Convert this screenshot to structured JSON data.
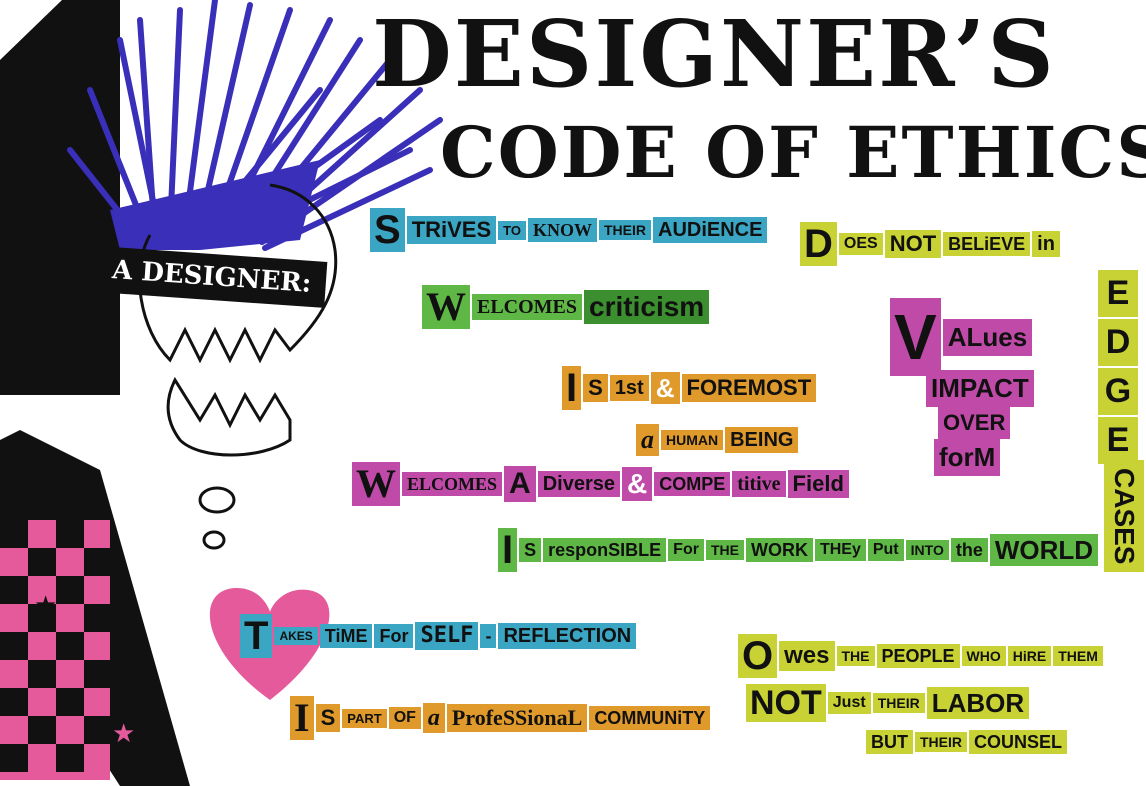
{
  "colors": {
    "teal": "#3aa6c4",
    "green": "#5fb845",
    "dark_green": "#3b8f2e",
    "magenta": "#c04aa8",
    "orange": "#e09a2b",
    "olive": "#c9d234",
    "mohawk": "#3a2fb8",
    "pink": "#e45a9a"
  },
  "title": {
    "line1": "DESIGNER’S",
    "line2": "CODE OF ETHICS"
  },
  "tag": "A DESIGNER:",
  "big_letter": "A",
  "phrases": {
    "strives": [
      "S",
      "TRiVES",
      "TO",
      "KNOW",
      "THEIR",
      "AUDiENCE"
    ],
    "welcomes_criticism": [
      "W",
      "ELCOMES",
      "criticism"
    ],
    "is_first": [
      "I",
      "S",
      "1st",
      "&",
      "FOREMOST"
    ],
    "human_being": [
      "a",
      "HUMAN",
      "BEING"
    ],
    "welcomes_diverse": [
      "W",
      "ELCOMES",
      "A",
      "Diverse",
      "&",
      "COMPE",
      "titive",
      "Field"
    ],
    "responsible": [
      "I",
      "S",
      "responSIBLE",
      "For",
      "THE",
      "WORK",
      "THEy",
      "Put",
      "INTO",
      "the",
      "WORLD"
    ],
    "takes_time": [
      "T",
      "AKES",
      "TiME",
      "For",
      "SELF",
      "-",
      "REFLECTION"
    ],
    "professional": [
      "I",
      "S",
      "PART",
      "OF",
      "a",
      "ProfeSSionaL",
      "COMMUNiTY"
    ],
    "does_not_believe": [
      "D",
      "OES",
      "NOT",
      "BELiEVE",
      "in"
    ],
    "edge": [
      "E",
      "D",
      "G",
      "E"
    ],
    "cases": "CASES",
    "values": [
      "V",
      "ALues",
      "IMPACT",
      "OVER",
      "forM"
    ],
    "owes": [
      "O",
      "wes",
      "THE",
      "PEOPLE",
      "WHO",
      "HiRE",
      "THEM"
    ],
    "not_just": [
      "NOT",
      "Just",
      "THEIR",
      "LABOR"
    ],
    "but_counsel": [
      "BUT",
      "THEIR",
      "COUNSEL"
    ]
  }
}
